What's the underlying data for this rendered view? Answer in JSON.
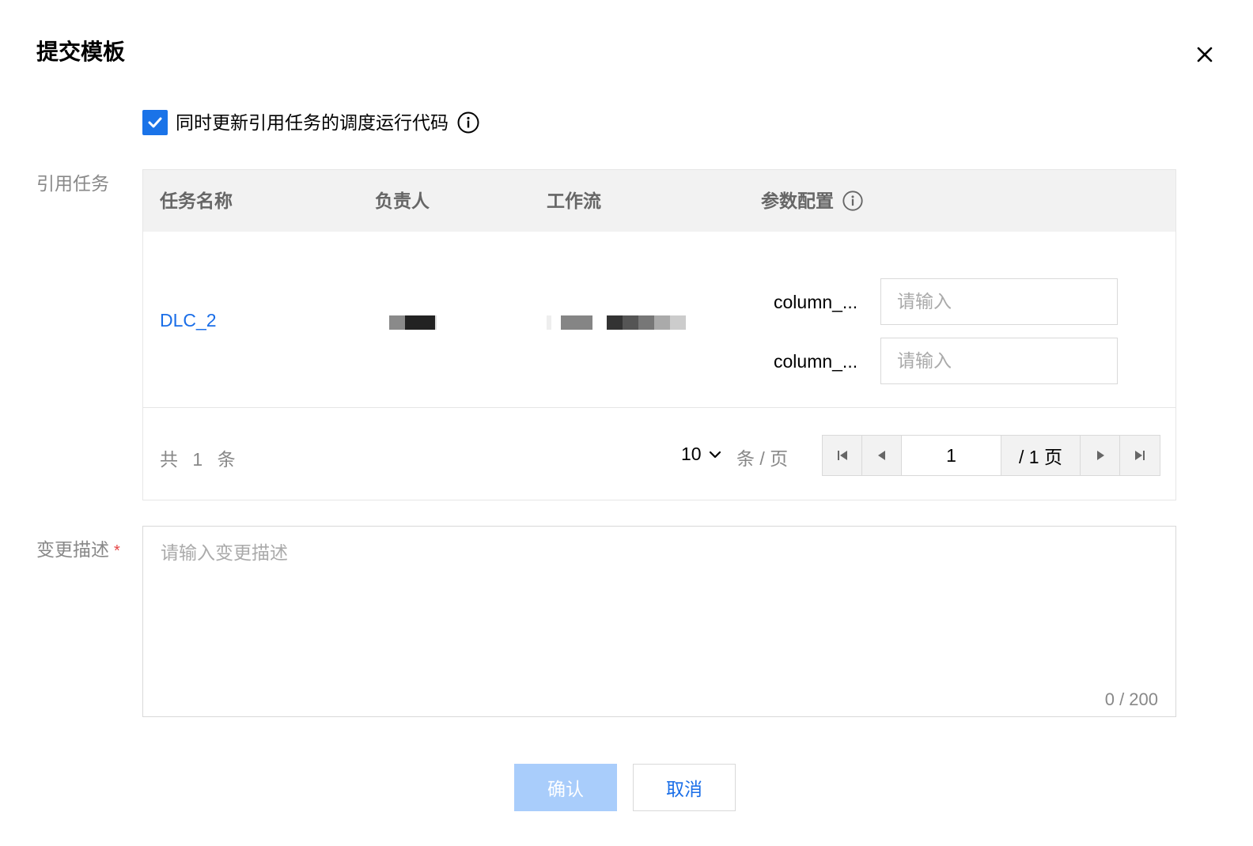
{
  "dialog": {
    "title": "提交模板"
  },
  "options": {
    "sync_checkbox_label": "同时更新引用任务的调度运行代码",
    "sync_checked": true
  },
  "labels": {
    "ref_tasks": "引用任务",
    "change_desc": "变更描述",
    "required_mark": "*"
  },
  "table": {
    "columns": [
      "任务名称",
      "负责人",
      "工作流",
      "参数配置"
    ],
    "rows": [
      {
        "task_name": "DLC_2",
        "params": [
          {
            "label": "column_...",
            "value": "",
            "placeholder": "请输入"
          },
          {
            "label": "column_...",
            "value": "",
            "placeholder": "请输入"
          }
        ]
      }
    ]
  },
  "pagination": {
    "total_text": "共 1 条",
    "page_size": "10",
    "per_page_label": "条 / 页",
    "current_page": "1",
    "total_pages_label": "/ 1 页"
  },
  "description": {
    "placeholder": "请输入变更描述",
    "value": "",
    "counter": "0 / 200"
  },
  "actions": {
    "confirm_label": "确认",
    "cancel_label": "取消"
  },
  "colors": {
    "primary": "#1a73e8",
    "link": "#1a6ee8",
    "confirm_disabled_bg": "#a9cdfb",
    "required": "#e54545"
  }
}
